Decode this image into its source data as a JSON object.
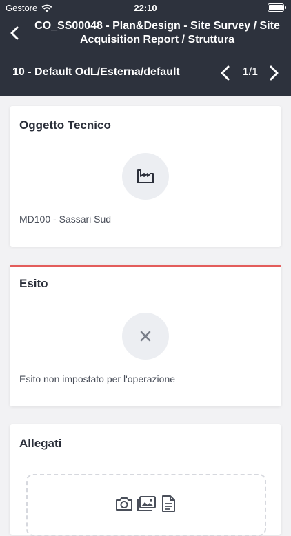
{
  "status_bar": {
    "carrier": "Gestore",
    "time": "22:10"
  },
  "nav": {
    "title": "CO_SS00048 - Plan&Design - Site Survey / Site Acquisition Report / Struttura"
  },
  "context_bar": {
    "label": "10 - Default OdL/Esterna/default",
    "pager": "1/1"
  },
  "cards": {
    "oggetto_tecnico": {
      "title": "Oggetto Tecnico",
      "icon": "factory-icon",
      "value": "MD100 - Sassari Sud"
    },
    "esito": {
      "title": "Esito",
      "icon": "close-icon",
      "value": "Esito non impostato per l'operazione",
      "accent_color": "#e35d5b"
    },
    "allegati": {
      "title": "Allegati",
      "icons": [
        "camera-icon",
        "gallery-icon",
        "document-icon"
      ]
    }
  },
  "colors": {
    "header_bg": "#2d323d",
    "page_bg": "#f2f2f4"
  }
}
